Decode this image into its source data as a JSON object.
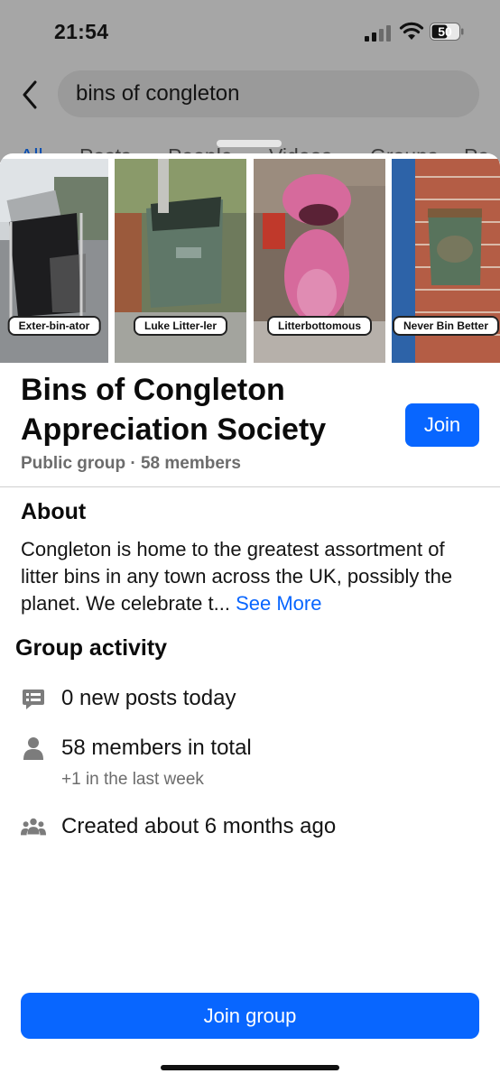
{
  "status_bar": {
    "time": "21:54",
    "battery": "50"
  },
  "search": {
    "query": "bins of congleton"
  },
  "tabs": [
    {
      "label": "All",
      "active": true
    },
    {
      "label": "Posts"
    },
    {
      "label": "People"
    },
    {
      "label": "Videos"
    },
    {
      "label": "Groups"
    },
    {
      "label": "Pa"
    }
  ],
  "photos": [
    {
      "caption": "Exter-bin-ator"
    },
    {
      "caption": "Luke Litter-ler"
    },
    {
      "caption": "Litterbottomous"
    },
    {
      "caption": "Never Bin Better"
    }
  ],
  "group": {
    "title": "Bins of Congleton Appreciation Society",
    "meta": "Public group · 58 members",
    "join_label": "Join"
  },
  "about": {
    "heading": "About",
    "body": "Congleton is home to the greatest assortment of litter bins in any town across the UK, possibly the planet. We celebrate t...",
    "see_more": "See More"
  },
  "activity": {
    "heading": "Group activity",
    "items": [
      {
        "icon": "posts-icon",
        "text": "0 new posts today"
      },
      {
        "icon": "person-icon",
        "text": "58 members in total",
        "sub": "+1 in the last week"
      },
      {
        "icon": "people-icon",
        "text": "Created about 6 months ago"
      }
    ]
  },
  "footer": {
    "join_group_label": "Join group"
  },
  "colors": {
    "accent": "#0866ff",
    "scrim": "#a6a6a6"
  }
}
